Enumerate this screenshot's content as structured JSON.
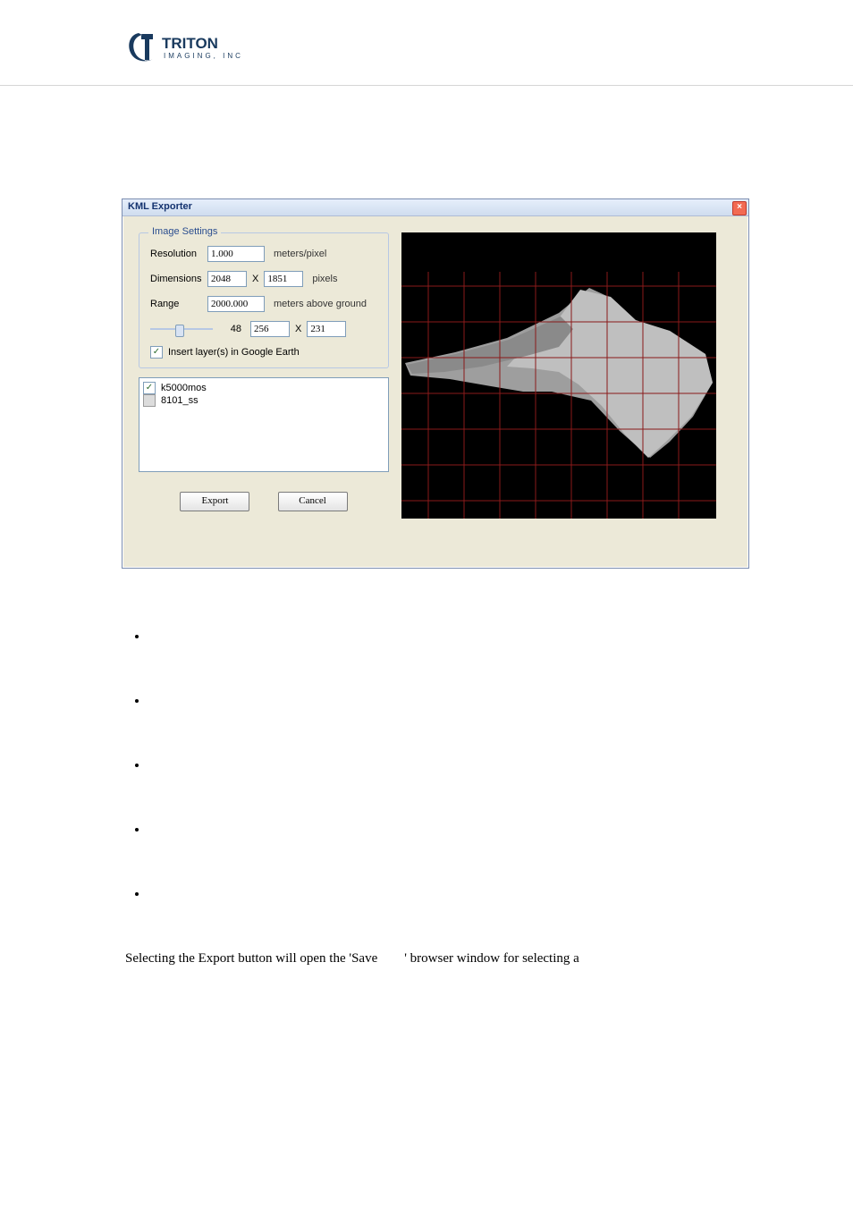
{
  "dialog": {
    "title": "KML Exporter",
    "group_legend": "Image Settings",
    "labels": {
      "resolution": "Resolution",
      "dimensions": "Dimensions",
      "range": "Range",
      "insert": "Insert layer(s) in Google Earth"
    },
    "units": {
      "mpp": "meters/pixel",
      "pixels": "pixels",
      "mag": "meters above ground"
    },
    "values": {
      "resolution": "1.000",
      "dim_w": "2048",
      "dim_h": "1851",
      "range": "2000.000",
      "slider_val": "48",
      "tile_w": "256",
      "tile_h": "231"
    },
    "x": "X",
    "layers": [
      {
        "name": "k5000mos",
        "checked": true
      },
      {
        "name": "8101_ss",
        "checked": false
      }
    ],
    "buttons": {
      "export": "Export",
      "cancel": "Cancel"
    }
  },
  "doc": {
    "sentence_a": "Selecting the Export button will open the 'Save",
    "sentence_b": "' browser window for selecting a"
  }
}
